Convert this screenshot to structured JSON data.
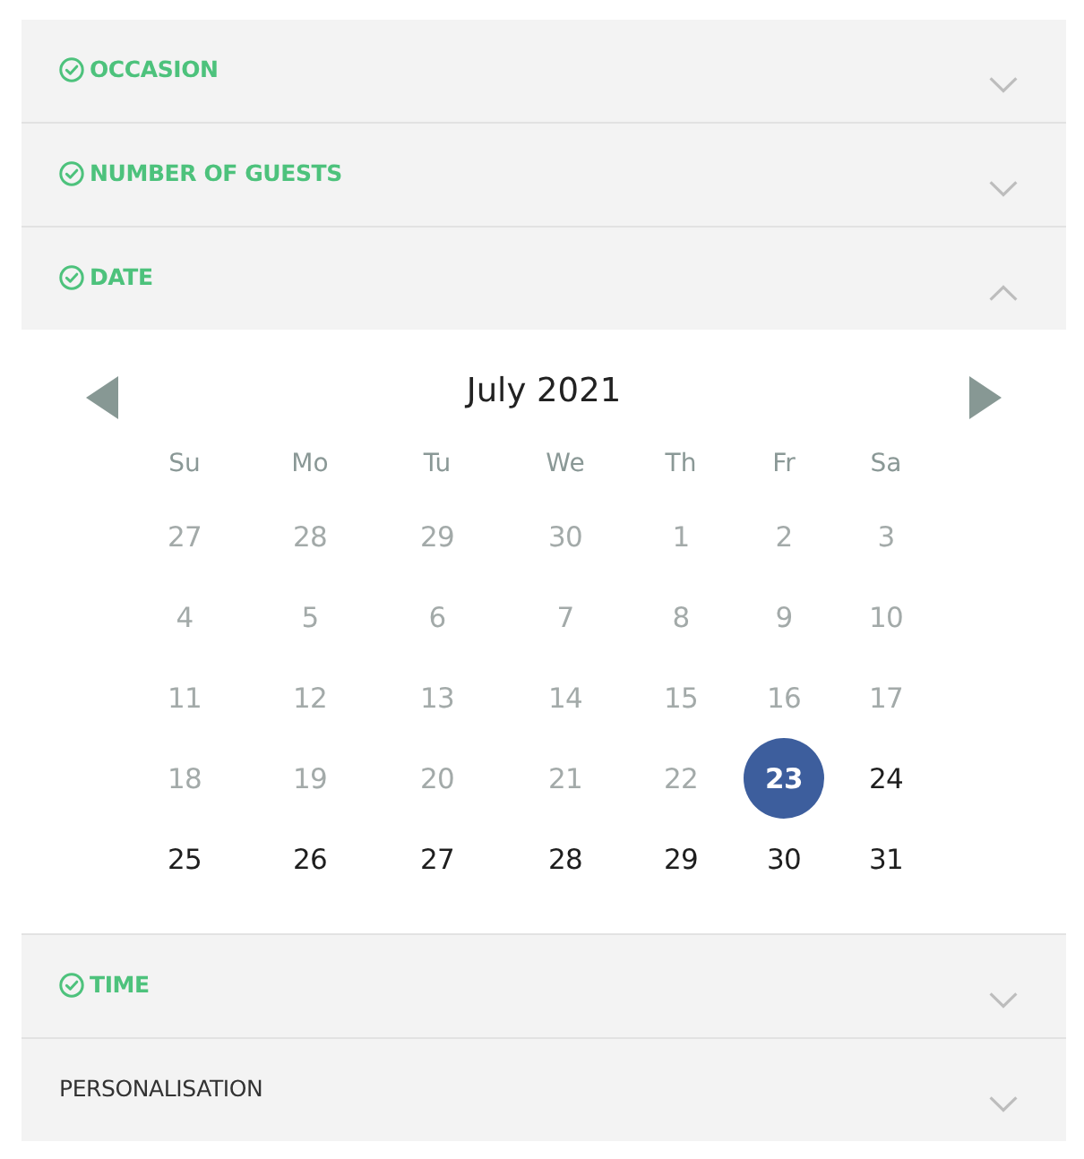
{
  "sections": [
    {
      "title": "OCCASION",
      "completed": true,
      "expanded": false
    },
    {
      "title": "NUMBER OF GUESTS",
      "completed": true,
      "expanded": false
    },
    {
      "title": "DATE",
      "completed": true,
      "expanded": true,
      "calendar": {
        "month_label": "July 2021",
        "weekdays": [
          "Su",
          "Mo",
          "Tu",
          "We",
          "Th",
          "Fr",
          "Sa"
        ],
        "weeks": [
          [
            {
              "label": "27",
              "disabled": true,
              "selected": false
            },
            {
              "label": "28",
              "disabled": true,
              "selected": false
            },
            {
              "label": "29",
              "disabled": true,
              "selected": false
            },
            {
              "label": "30",
              "disabled": true,
              "selected": false
            },
            {
              "label": "1",
              "disabled": true,
              "selected": false
            },
            {
              "label": "2",
              "disabled": true,
              "selected": false
            },
            {
              "label": "3",
              "disabled": true,
              "selected": false
            }
          ],
          [
            {
              "label": "4",
              "disabled": true,
              "selected": false
            },
            {
              "label": "5",
              "disabled": true,
              "selected": false
            },
            {
              "label": "6",
              "disabled": true,
              "selected": false
            },
            {
              "label": "7",
              "disabled": true,
              "selected": false
            },
            {
              "label": "8",
              "disabled": true,
              "selected": false
            },
            {
              "label": "9",
              "disabled": true,
              "selected": false
            },
            {
              "label": "10",
              "disabled": true,
              "selected": false
            }
          ],
          [
            {
              "label": "11",
              "disabled": true,
              "selected": false
            },
            {
              "label": "12",
              "disabled": true,
              "selected": false
            },
            {
              "label": "13",
              "disabled": true,
              "selected": false
            },
            {
              "label": "14",
              "disabled": true,
              "selected": false
            },
            {
              "label": "15",
              "disabled": true,
              "selected": false
            },
            {
              "label": "16",
              "disabled": true,
              "selected": false
            },
            {
              "label": "17",
              "disabled": true,
              "selected": false
            }
          ],
          [
            {
              "label": "18",
              "disabled": true,
              "selected": false
            },
            {
              "label": "19",
              "disabled": true,
              "selected": false
            },
            {
              "label": "20",
              "disabled": true,
              "selected": false
            },
            {
              "label": "21",
              "disabled": true,
              "selected": false
            },
            {
              "label": "22",
              "disabled": true,
              "selected": false
            },
            {
              "label": "23",
              "disabled": false,
              "selected": true
            },
            {
              "label": "24",
              "disabled": false,
              "selected": false
            }
          ],
          [
            {
              "label": "25",
              "disabled": false,
              "selected": false
            },
            {
              "label": "26",
              "disabled": false,
              "selected": false
            },
            {
              "label": "27",
              "disabled": false,
              "selected": false
            },
            {
              "label": "28",
              "disabled": false,
              "selected": false
            },
            {
              "label": "29",
              "disabled": false,
              "selected": false
            },
            {
              "label": "30",
              "disabled": false,
              "selected": false
            },
            {
              "label": "31",
              "disabled": false,
              "selected": false
            }
          ]
        ]
      }
    },
    {
      "title": "TIME",
      "completed": true,
      "expanded": false
    },
    {
      "title": "PERSONALISATION",
      "completed": false,
      "expanded": false
    }
  ]
}
